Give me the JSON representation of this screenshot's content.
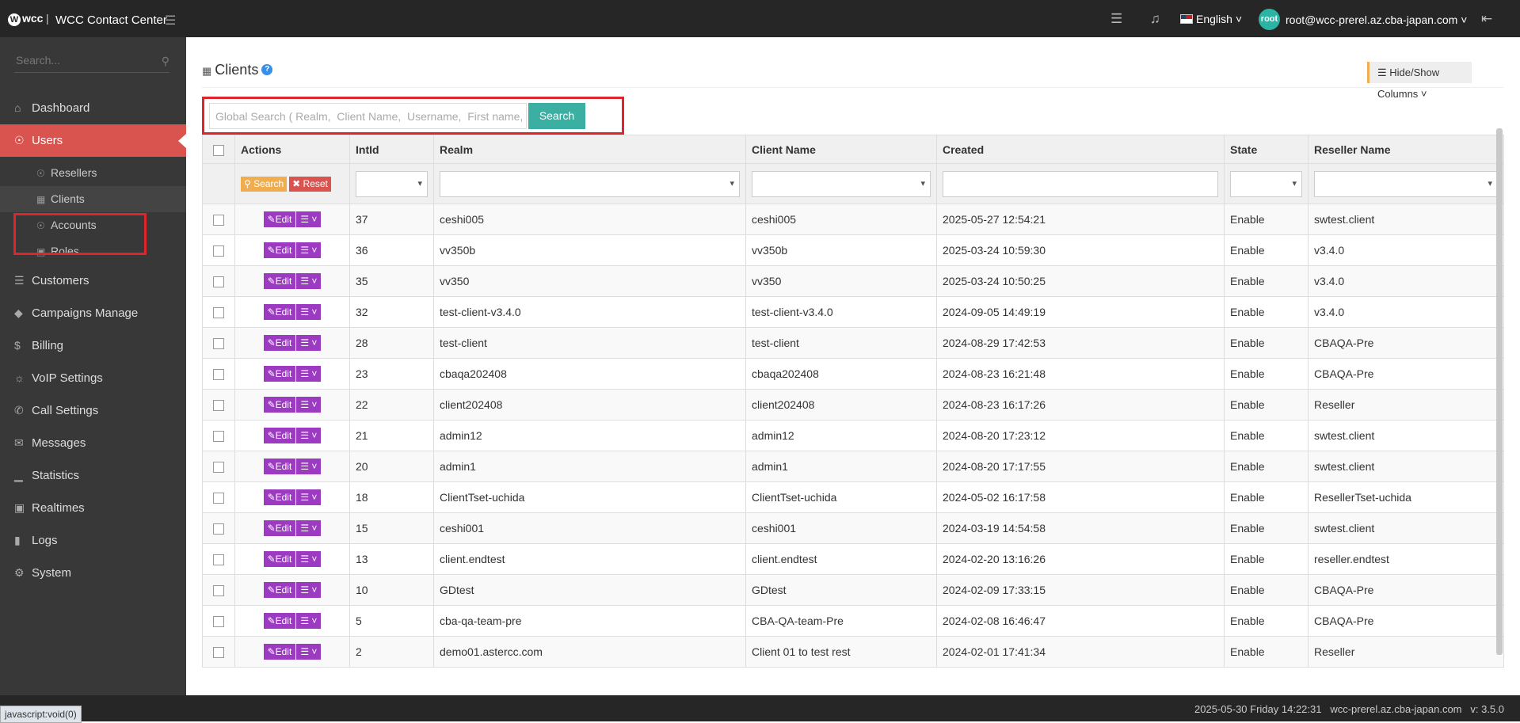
{
  "app": {
    "logo": "wcc",
    "title": "WCC Contact Center"
  },
  "header": {
    "language": "English",
    "avatar_text": "root",
    "user": "root@wcc-prerel.az.cba-japan.com"
  },
  "sidebar": {
    "search_placeholder": "Search...",
    "items": [
      {
        "label": "Dashboard"
      },
      {
        "label": "Users"
      },
      {
        "label": "Customers"
      },
      {
        "label": "Campaigns Manage"
      },
      {
        "label": "Billing"
      },
      {
        "label": "VoIP Settings"
      },
      {
        "label": "Call Settings"
      },
      {
        "label": "Messages"
      },
      {
        "label": "Statistics"
      },
      {
        "label": "Realtimes"
      },
      {
        "label": "Logs"
      },
      {
        "label": "System"
      }
    ],
    "users_sub": [
      {
        "label": "Resellers"
      },
      {
        "label": "Clients"
      },
      {
        "label": "Accounts"
      },
      {
        "label": "Roles"
      }
    ]
  },
  "page": {
    "title": "Clients",
    "help": "?",
    "hide_show_label": "Hide/Show Columns",
    "global_search_placeholder": "Global Search ( Realm,  Client Name,  Username,  First name,  Last name )",
    "search_button": "Search"
  },
  "table": {
    "headers": [
      "Actions",
      "IntId",
      "Realm",
      "Client Name",
      "Created",
      "State",
      "Reseller Name"
    ],
    "filter_search": "Search",
    "filter_reset": "Reset",
    "edit_label": "Edit",
    "rows": [
      {
        "id": "37",
        "realm": "ceshi005",
        "client": "ceshi005",
        "created": "2025-05-27 12:54:21",
        "state": "Enable",
        "reseller": "swtest.client"
      },
      {
        "id": "36",
        "realm": "vv350b",
        "client": "vv350b",
        "created": "2025-03-24 10:59:30",
        "state": "Enable",
        "reseller": "v3.4.0"
      },
      {
        "id": "35",
        "realm": "vv350",
        "client": "vv350",
        "created": "2025-03-24 10:50:25",
        "state": "Enable",
        "reseller": "v3.4.0"
      },
      {
        "id": "32",
        "realm": "test-client-v3.4.0",
        "client": "test-client-v3.4.0",
        "created": "2024-09-05 14:49:19",
        "state": "Enable",
        "reseller": "v3.4.0"
      },
      {
        "id": "28",
        "realm": "test-client",
        "client": "test-client",
        "created": "2024-08-29 17:42:53",
        "state": "Enable",
        "reseller": "CBAQA-Pre"
      },
      {
        "id": "23",
        "realm": "cbaqa202408",
        "client": "cbaqa202408",
        "created": "2024-08-23 16:21:48",
        "state": "Enable",
        "reseller": "CBAQA-Pre"
      },
      {
        "id": "22",
        "realm": "client202408",
        "client": "client202408",
        "created": "2024-08-23 16:17:26",
        "state": "Enable",
        "reseller": "Reseller"
      },
      {
        "id": "21",
        "realm": "admin12",
        "client": "admin12",
        "created": "2024-08-20 17:23:12",
        "state": "Enable",
        "reseller": "swtest.client"
      },
      {
        "id": "20",
        "realm": "admin1",
        "client": "admin1",
        "created": "2024-08-20 17:17:55",
        "state": "Enable",
        "reseller": "swtest.client"
      },
      {
        "id": "18",
        "realm": "ClientTset-uchida",
        "client": "ClientTset-uchida",
        "created": "2024-05-02 16:17:58",
        "state": "Enable",
        "reseller": "ResellerTset-uchida"
      },
      {
        "id": "15",
        "realm": "ceshi001",
        "client": "ceshi001",
        "created": "2024-03-19 14:54:58",
        "state": "Enable",
        "reseller": "swtest.client"
      },
      {
        "id": "13",
        "realm": "client.endtest",
        "client": "client.endtest",
        "created": "2024-02-20 13:16:26",
        "state": "Enable",
        "reseller": "reseller.endtest"
      },
      {
        "id": "10",
        "realm": "GDtest",
        "client": "GDtest",
        "created": "2024-02-09 17:33:15",
        "state": "Enable",
        "reseller": "CBAQA-Pre"
      },
      {
        "id": "5",
        "realm": "cba-qa-team-pre",
        "client": "CBA-QA-team-Pre",
        "created": "2024-02-08 16:46:47",
        "state": "Enable",
        "reseller": "CBAQA-Pre"
      },
      {
        "id": "2",
        "realm": "demo01.astercc.com",
        "client": "Client 01 to test rest",
        "created": "2024-02-01 17:41:34",
        "state": "Enable",
        "reseller": "Reseller"
      }
    ]
  },
  "footer": {
    "datetime": "2025-05-30 Friday 14:22:31",
    "host": "wcc-prerel.az.cba-japan.com",
    "version": "v: 3.5.0"
  },
  "status_bar": "javascript:void(0)",
  "colors": {
    "accent": "#d9534f",
    "teal": "#3bafa2",
    "purple": "#9c3ac1",
    "highlight": "#e0242b"
  }
}
